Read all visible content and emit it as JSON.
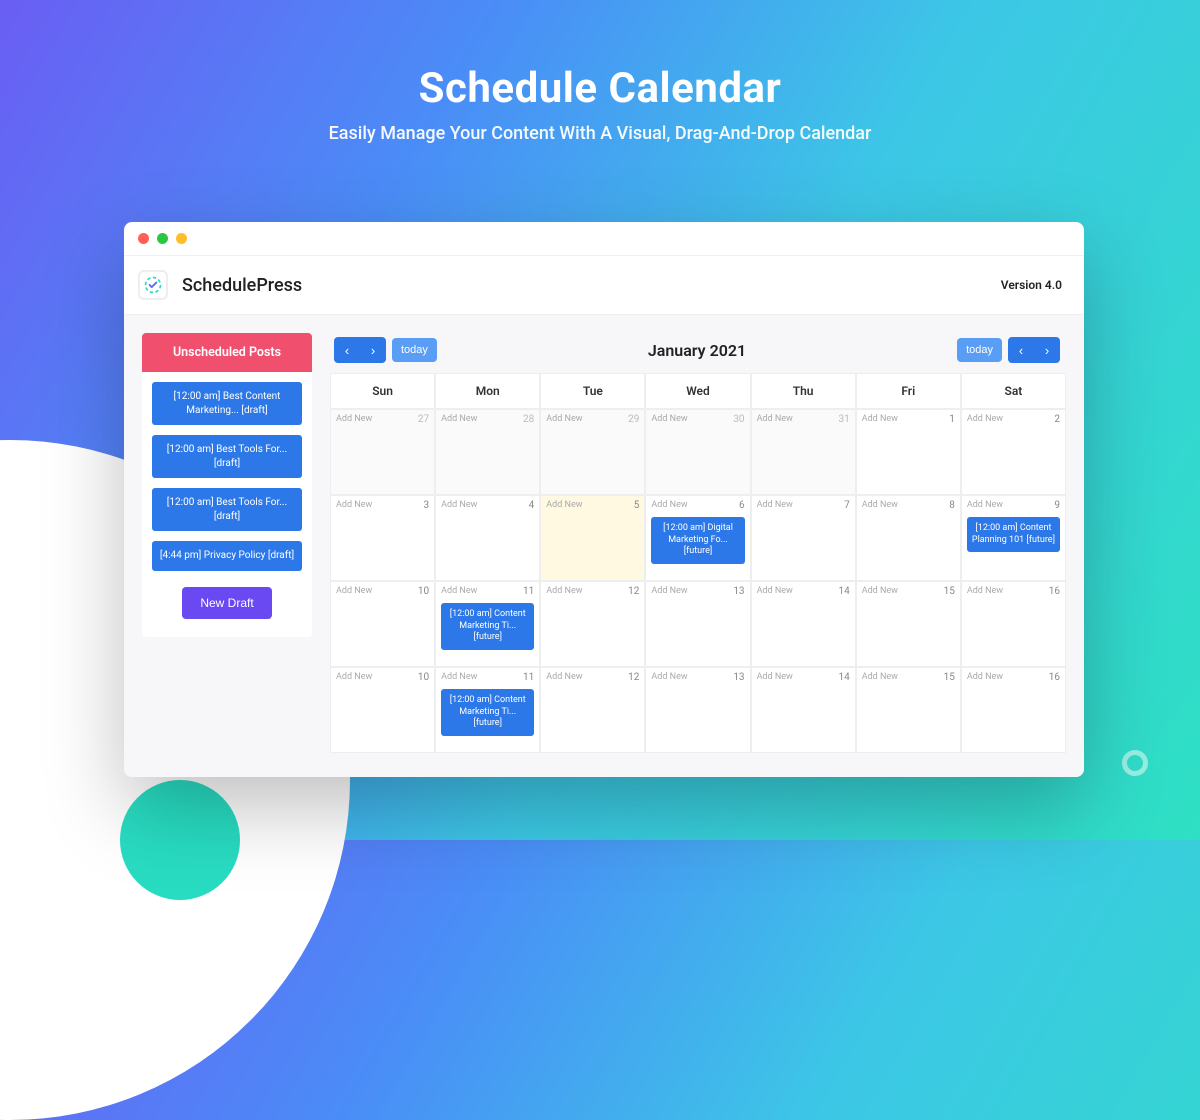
{
  "hero": {
    "title": "Schedule Calendar",
    "subtitle": "Easily Manage Your Content With A Visual, Drag-And-Drop Calendar"
  },
  "app": {
    "name": "SchedulePress",
    "version": "Version 4.0"
  },
  "sidebar": {
    "title": "Unscheduled Posts",
    "drafts": [
      "[12:00 am] Best Content Marketing... [draft]",
      "[12:00 am] Best Tools For... [draft]",
      "[12:00 am] Best Tools For... [draft]",
      "[4:44 pm] Privacy Policy [draft]"
    ],
    "new_draft": "New Draft"
  },
  "calendar": {
    "today": "today",
    "title": "January 2021",
    "days": [
      "Sun",
      "Mon",
      "Tue",
      "Wed",
      "Thu",
      "Fri",
      "Sat"
    ],
    "add_new": "Add New",
    "rows": [
      [
        {
          "n": "27",
          "prev": true
        },
        {
          "n": "28",
          "prev": true
        },
        {
          "n": "29",
          "prev": true
        },
        {
          "n": "30",
          "prev": true
        },
        {
          "n": "31",
          "prev": true
        },
        {
          "n": "1"
        },
        {
          "n": "2"
        }
      ],
      [
        {
          "n": "3"
        },
        {
          "n": "4"
        },
        {
          "n": "5",
          "hl": true
        },
        {
          "n": "6",
          "event": "[12:00 am] Digital Marketing Fo... [future]"
        },
        {
          "n": "7"
        },
        {
          "n": "8"
        },
        {
          "n": "9",
          "event": "[12:00 am] Content Planning 101 [future]"
        }
      ],
      [
        {
          "n": "10"
        },
        {
          "n": "11",
          "event": "[12:00 am] Content Marketing Ti... [future]"
        },
        {
          "n": "12"
        },
        {
          "n": "13"
        },
        {
          "n": "14"
        },
        {
          "n": "15"
        },
        {
          "n": "16"
        }
      ],
      [
        {
          "n": "10"
        },
        {
          "n": "11",
          "event": "[12:00 am] Content Marketing Ti... [future]"
        },
        {
          "n": "12"
        },
        {
          "n": "13"
        },
        {
          "n": "14"
        },
        {
          "n": "15"
        },
        {
          "n": "16"
        }
      ]
    ]
  }
}
